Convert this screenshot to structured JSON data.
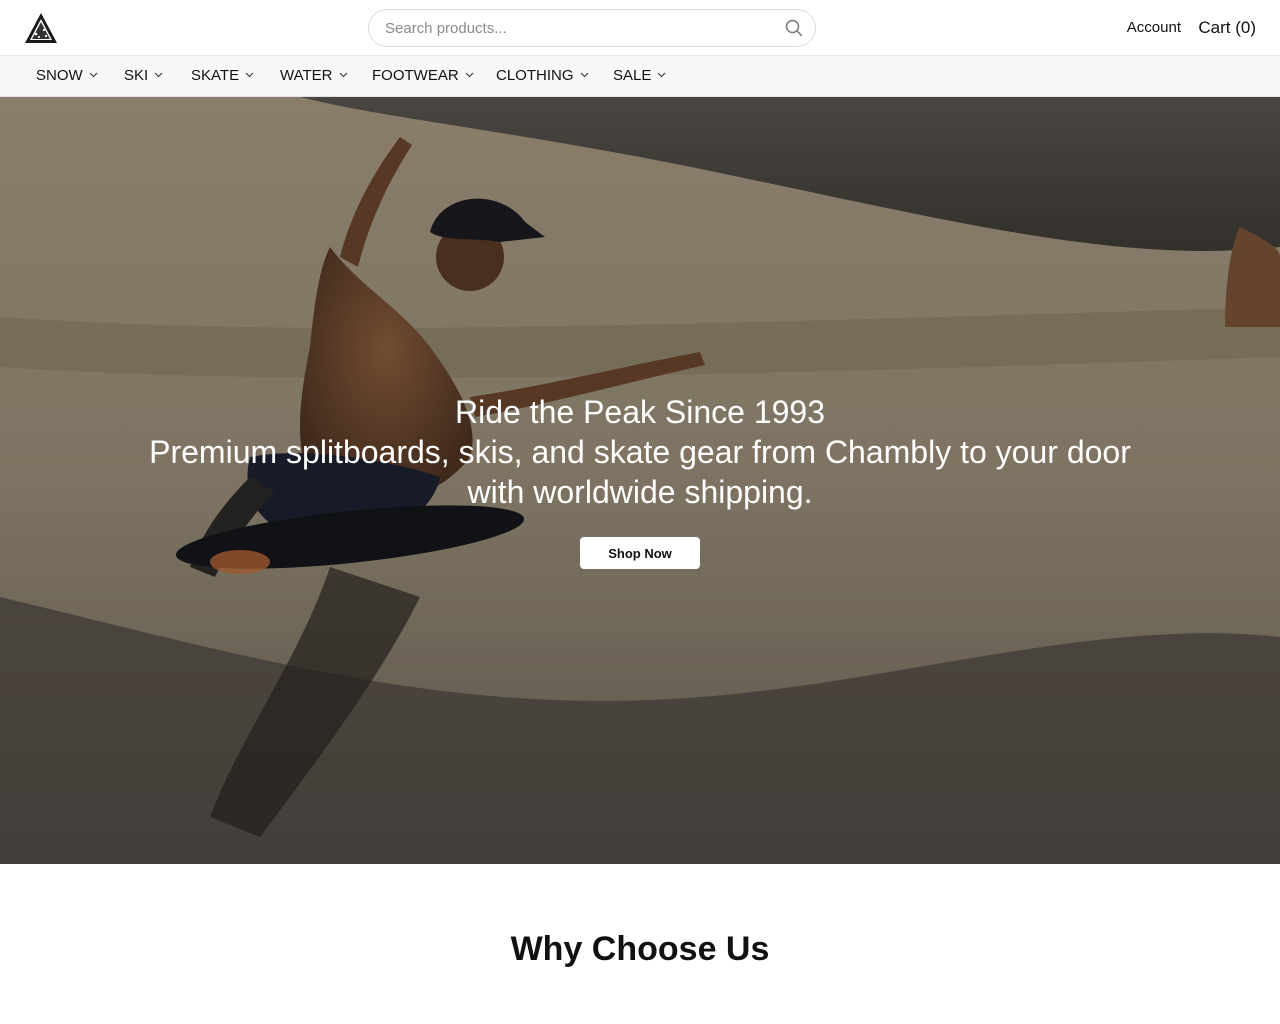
{
  "header": {
    "logo_icon": "mountain-triangle-logo-icon",
    "search": {
      "placeholder": "Search products...",
      "value": "",
      "icon": "search-icon"
    },
    "account_label": "Account",
    "cart_label": "Cart (0)"
  },
  "nav": {
    "items": [
      {
        "label": "SNOW"
      },
      {
        "label": "SKI"
      },
      {
        "label": "SKATE"
      },
      {
        "label": "WATER"
      },
      {
        "label": "FOOTWEAR"
      },
      {
        "label": "CLOTHING"
      },
      {
        "label": "SALE"
      }
    ],
    "chevron_icon": "chevron-down-icon"
  },
  "hero": {
    "title": "Ride the Peak Since 1993",
    "subtitle": "Premium splitboards, skis, and skate gear from Chambly to your door with worldwide shipping.",
    "cta_label": "Shop Now"
  },
  "why": {
    "title": "Why Choose Us"
  },
  "colors": {
    "nav_bg": "#f7f8fa",
    "button_bg": "#ffffff",
    "text": "#111111"
  }
}
